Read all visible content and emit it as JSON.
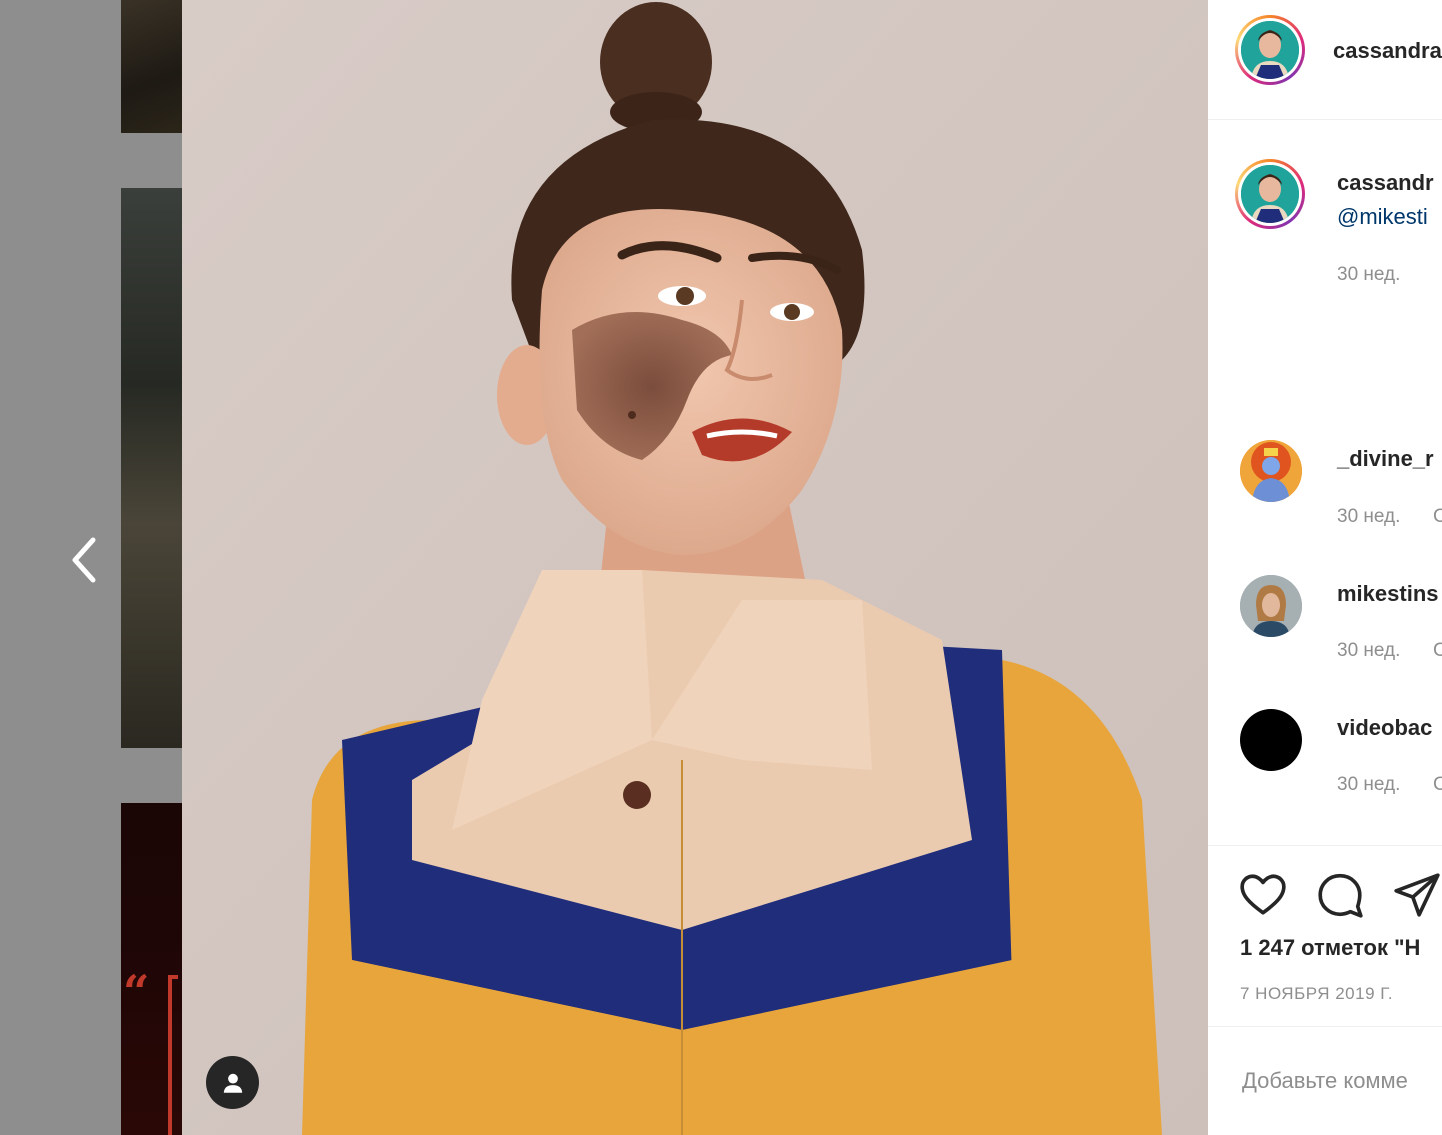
{
  "post": {
    "author": "cassandra",
    "caption_author": "cassandr",
    "caption_mention": "@mikesti",
    "caption_time": "30 нед.",
    "likes": "1 247 отметок \"Н",
    "date": "7 НОЯБРЯ 2019 Г.",
    "add_comment_placeholder": "Добавьте комме"
  },
  "comments": [
    {
      "username": "_divine_r",
      "time": "30 нед.",
      "reply": "C"
    },
    {
      "username": "mikestins",
      "time": "30 нед.",
      "reply": "C"
    },
    {
      "username": "videobac",
      "time": "30 нед.",
      "reply": "C"
    }
  ],
  "icons": {
    "prev": "chevron-left-icon",
    "user_tag": "user-icon",
    "like": "heart-icon",
    "comment": "comment-icon",
    "share": "paper-plane-icon"
  },
  "colors": {
    "username": "#262626",
    "mention": "#00376b",
    "meta": "#8e8e8e",
    "overlay": "#8e8e8e"
  }
}
